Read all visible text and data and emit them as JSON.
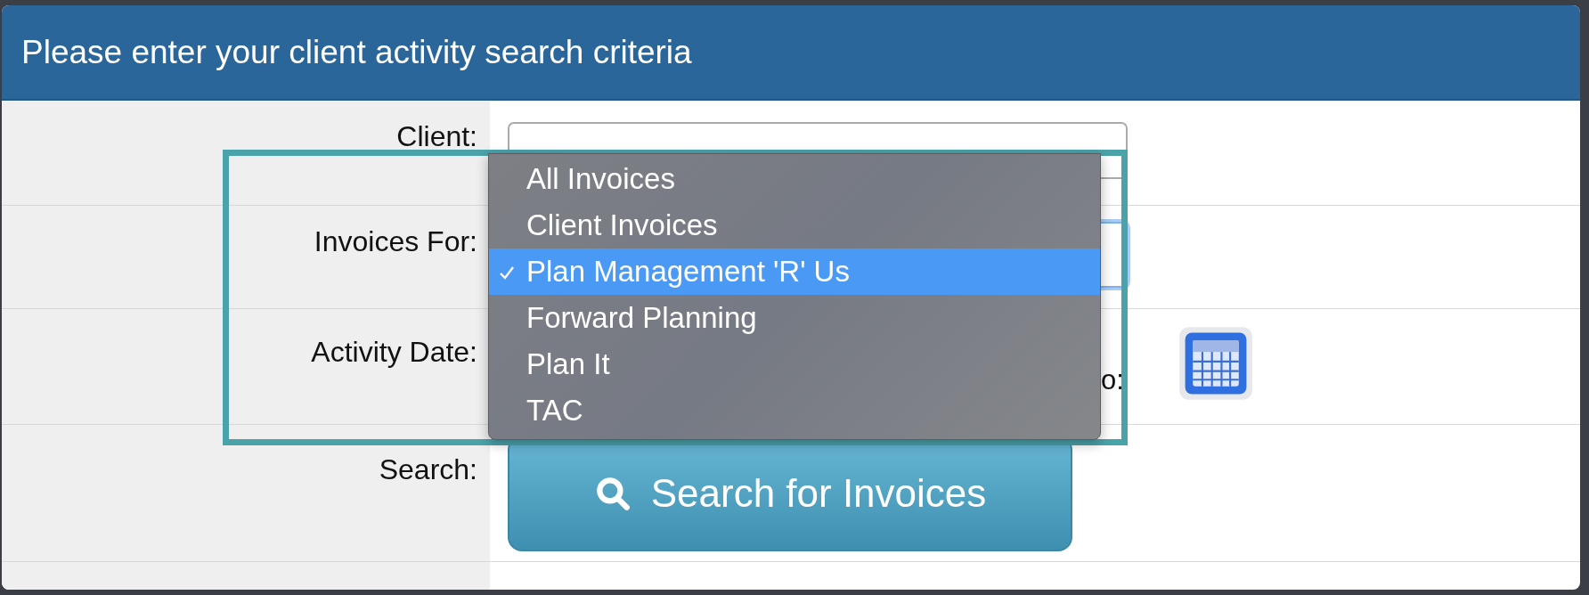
{
  "header": {
    "title": "Please enter your client activity search criteria"
  },
  "fields": [
    {
      "label": "Client:"
    },
    {
      "label": "Invoices For:"
    },
    {
      "label": "Activity Date:",
      "to_label": "o:"
    },
    {
      "label": "Search:"
    }
  ],
  "dropdown": {
    "options": [
      {
        "label": "All Invoices",
        "selected": false
      },
      {
        "label": "Client Invoices",
        "selected": false
      },
      {
        "label": "Plan Management 'R' Us",
        "selected": true
      },
      {
        "label": "Forward Planning",
        "selected": false
      },
      {
        "label": "Plan It",
        "selected": false
      },
      {
        "label": "TAC",
        "selected": false
      }
    ]
  },
  "search_button": {
    "label": "Search for Invoices"
  }
}
